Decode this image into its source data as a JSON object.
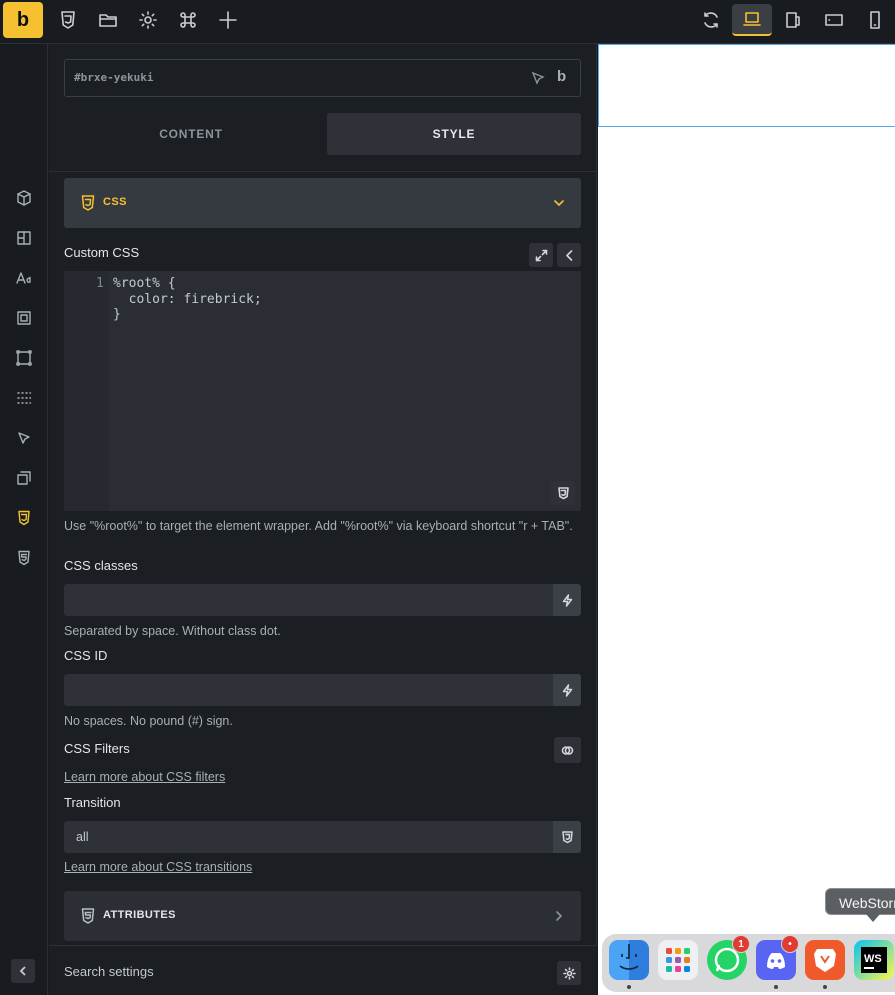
{
  "app": {
    "logo_letter": "b",
    "accent": "#f6c131"
  },
  "toolbar": {
    "left_icons": [
      "css3-icon",
      "folder-icon",
      "gear-icon",
      "command-icon",
      "plus-icon"
    ],
    "right_icons": [
      "refresh-icon",
      "laptop-icon",
      "tablet-landscape-icon",
      "tablet-icon",
      "phone-icon"
    ]
  },
  "rail": {
    "icons": [
      "cube-icon",
      "layout-icon",
      "typography-icon",
      "spacing-icon",
      "border-icon",
      "effects-icon",
      "cursor-icon",
      "transform-icon",
      "css3-icon",
      "html5-icon"
    ],
    "active": "css3-icon"
  },
  "element_id": "#brxe-yekuki",
  "tabs": {
    "content": "CONTENT",
    "style": "STYLE",
    "active": "style"
  },
  "css_section": {
    "title": "CSS",
    "custom_css_label": "Custom CSS",
    "line_number": "1",
    "code": "%root% {\n  color: firebrick;\n}",
    "hint": "Use \"%root%\" to target the element wrapper. Add \"%root%\" via keyboard shortcut \"r + TAB\".",
    "classes_label": "CSS classes",
    "classes_value": "",
    "classes_hint": "Separated by space. Without class dot.",
    "id_label": "CSS ID",
    "id_value": "",
    "id_hint": "No spaces. No pound (#) sign.",
    "filters_label": "CSS Filters",
    "filters_link": "Learn more about CSS filters",
    "transition_label": "Transition",
    "transition_value": "all",
    "transition_link": "Learn more about CSS transitions"
  },
  "attributes_section": {
    "title": "ATTRIBUTES"
  },
  "search": {
    "placeholder": "Search settings"
  },
  "dock": {
    "tooltip": "WebStorm",
    "apps": [
      "finder",
      "launchpad",
      "whatsapp",
      "discord",
      "brave",
      "webstorm"
    ],
    "badges": {
      "whatsapp": "1",
      "discord": "•"
    }
  }
}
